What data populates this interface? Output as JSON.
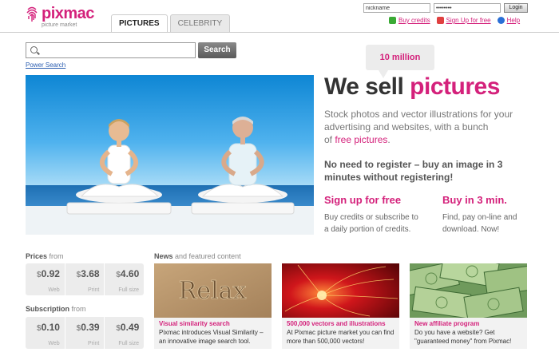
{
  "brand": {
    "name": "pixmac",
    "subtitle": "picture market",
    "color": "#d4217b"
  },
  "tabs": [
    {
      "label": "PICTURES",
      "active": true
    },
    {
      "label": "CELEBRITY",
      "active": false
    }
  ],
  "login": {
    "username_value": "nickname",
    "password_value": "••••••••",
    "login_label": "Login"
  },
  "account_links": [
    {
      "label": "Buy credits",
      "icon": "credits-icon",
      "icon_color": "#3aaa35"
    },
    {
      "label": "Sign Up for free",
      "icon": "signup-icon",
      "icon_color": "#e04040"
    },
    {
      "label": "Help",
      "icon": "help-icon",
      "icon_color": "#2a6fd6"
    }
  ],
  "search": {
    "placeholder": "",
    "button_label": "Search",
    "power_search_label": "Power Search"
  },
  "hero": {
    "badge": "10 million",
    "headline_plain": "We sell ",
    "headline_accent": "pictures",
    "tagline_line1": "Stock photos and vector illustrations for your advertising and websites, with a bunch",
    "tagline_prefix": "of ",
    "tagline_accent": "free pictures",
    "tagline_suffix": ".",
    "tagline_bold": "No need to register – buy an image in 3 minutes without registering!"
  },
  "cta": [
    {
      "title": "Sign up for free",
      "line1": "Buy credits or subscribe to",
      "line2": "a daily portion of credits."
    },
    {
      "title": "Buy in 3 min.",
      "line1": "Find, pay on-line and",
      "line2": "download. Now!"
    }
  ],
  "prices": {
    "title": "Prices",
    "title_suffix": "from",
    "items": [
      {
        "currency": "$",
        "value": "0.92",
        "label": "Web"
      },
      {
        "currency": "$",
        "value": "3.68",
        "label": "Print"
      },
      {
        "currency": "$",
        "value": "4.60",
        "label": "Full size"
      }
    ]
  },
  "subscription": {
    "title": "Subscription",
    "title_suffix": "from",
    "items": [
      {
        "currency": "$",
        "value": "0.10",
        "label": "Web"
      },
      {
        "currency": "$",
        "value": "0.39",
        "label": "Print"
      },
      {
        "currency": "$",
        "value": "0.49",
        "label": "Full size"
      }
    ]
  },
  "news": {
    "title": "News",
    "title_suffix": "and featured content",
    "items": [
      {
        "image_text": "Relax",
        "title": "Visual similarity search",
        "desc_line1": "Pixmac introduces Visual Similarity –",
        "desc_line2": "an innovative image search tool."
      },
      {
        "title": "500,000 vectors and illustrations",
        "desc_line1": "At Pixmac picture market you can find",
        "desc_line2": "more than 500,000 vectors!"
      },
      {
        "title": "New affiliate program",
        "desc_line1": "Do you have a website? Get",
        "desc_line2": "\"guaranteed money\" from Pixmac!"
      }
    ]
  }
}
